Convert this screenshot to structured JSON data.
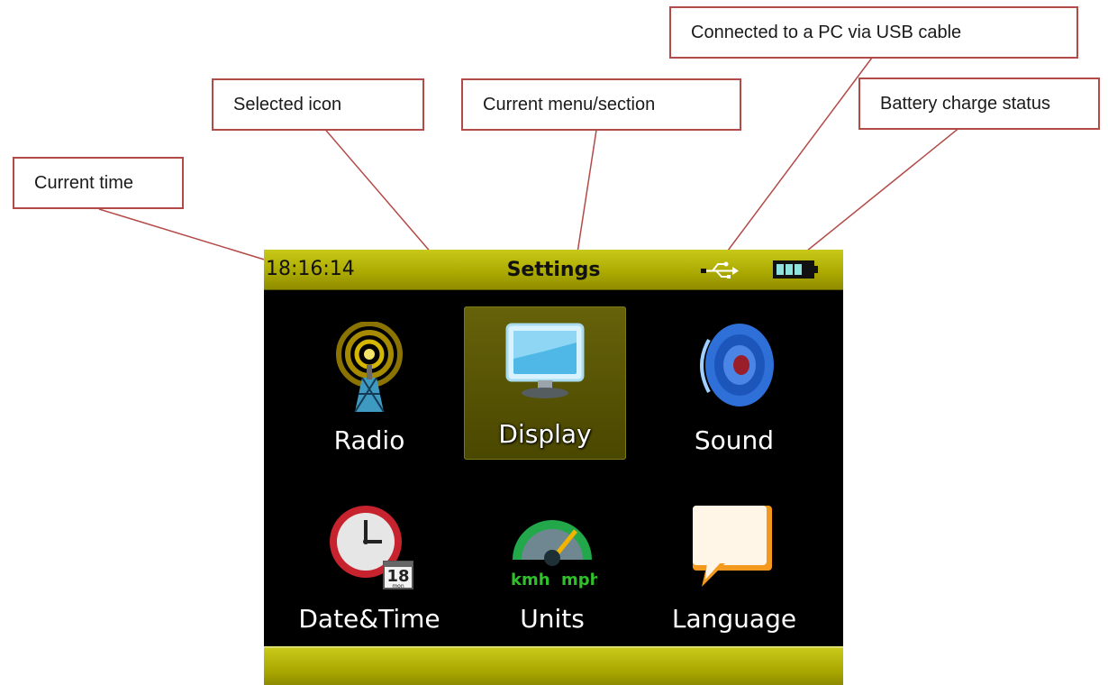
{
  "callouts": {
    "current_time": "Current time",
    "selected_icon": "Selected icon",
    "current_menu": "Current menu/section",
    "usb_connection": "Connected to a PC via USB cable",
    "battery_status": "Battery charge status"
  },
  "device": {
    "status_bar": {
      "time": "18:16:14",
      "menu_title": "Settings",
      "usb_icon": "usb-icon",
      "battery_icon": "battery-icon",
      "battery_level": 0.75
    },
    "menu_items": [
      {
        "label": "Radio",
        "icon": "radio-tower-icon",
        "selected": false
      },
      {
        "label": "Display",
        "icon": "monitor-icon",
        "selected": true
      },
      {
        "label": "Sound",
        "icon": "speaker-icon",
        "selected": false
      },
      {
        "label": "Date&Time",
        "icon": "clock-calendar-icon",
        "selected": false,
        "calendar_day": "18",
        "calendar_weekday": "mon"
      },
      {
        "label": "Units",
        "icon": "speedometer-icon",
        "selected": false,
        "unit_left": "kmh",
        "unit_right": "mph"
      },
      {
        "label": "Language",
        "icon": "speech-bubble-icon",
        "selected": false
      }
    ]
  },
  "colors": {
    "callout_border": "#b24a47",
    "status_bar": "#b3b100",
    "selected_tile": "#5a5705",
    "screen_bg": "#000000"
  }
}
